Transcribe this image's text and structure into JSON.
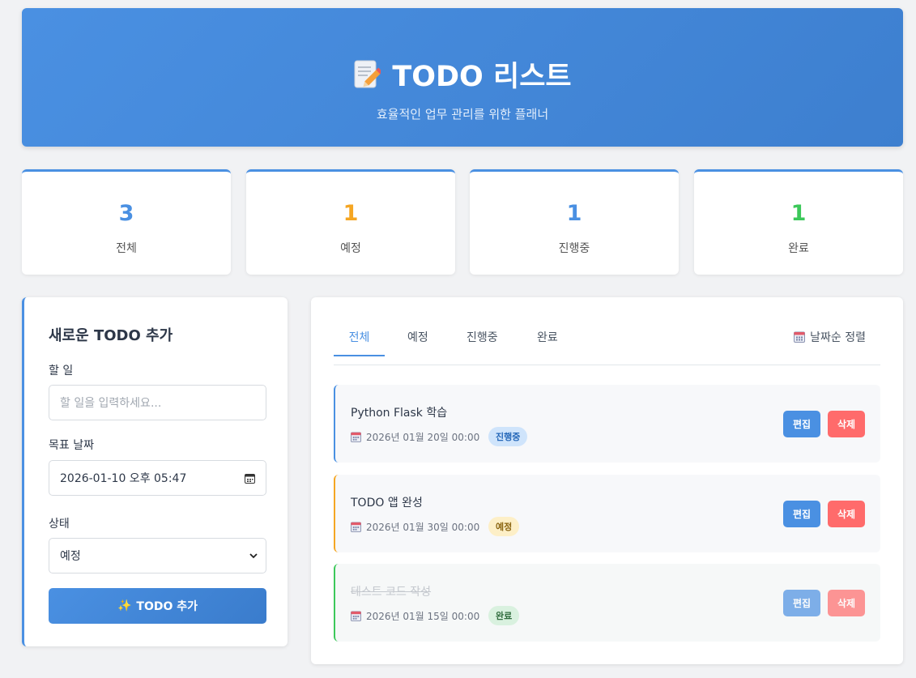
{
  "header": {
    "title": "TODO 리스트",
    "subtitle": "효율적인 업무 관리를 위한 플래너",
    "icon": "memo-icon"
  },
  "stats": [
    {
      "value": "3",
      "label": "전체",
      "color": "#4a90e2"
    },
    {
      "value": "1",
      "label": "예정",
      "color": "#f5a623"
    },
    {
      "value": "1",
      "label": "진행중",
      "color": "#4a90e2"
    },
    {
      "value": "1",
      "label": "완료",
      "color": "#3cc85a"
    }
  ],
  "form": {
    "title": "새로운 TODO 추가",
    "task_label": "할 일",
    "task_placeholder": "할 일을 입력하세요...",
    "date_label": "목표 날짜",
    "date_value": "2026-01-10 오후 05:47",
    "status_label": "상태",
    "status_value": "예정",
    "submit": "TODO 추가",
    "submit_icon": "✨"
  },
  "list": {
    "tabs": [
      "전체",
      "예정",
      "진행중",
      "완료"
    ],
    "active_tab": "전체",
    "sort_label": "날짜순 정렬",
    "items": [
      {
        "title": "Python Flask 학습",
        "date": "2026년 01월 20일 00:00",
        "status": "진행중",
        "badge_bg": "#cfe4fb",
        "badge_fg": "#2467b8",
        "accent": "#4a90e2"
      },
      {
        "title": "TODO 앱 완성",
        "date": "2026년 01월 30일 00:00",
        "status": "예정",
        "badge_bg": "#fdefc7",
        "badge_fg": "#8a6410",
        "accent": "#f5a623"
      },
      {
        "title": "테스트 코드 작성",
        "date": "2026년 01월 15일 00:00",
        "status": "완료",
        "badge_bg": "#d9f1df",
        "badge_fg": "#2e6b3c",
        "accent": "#3cc85a"
      }
    ],
    "edit_label": "편집",
    "delete_label": "삭제"
  }
}
